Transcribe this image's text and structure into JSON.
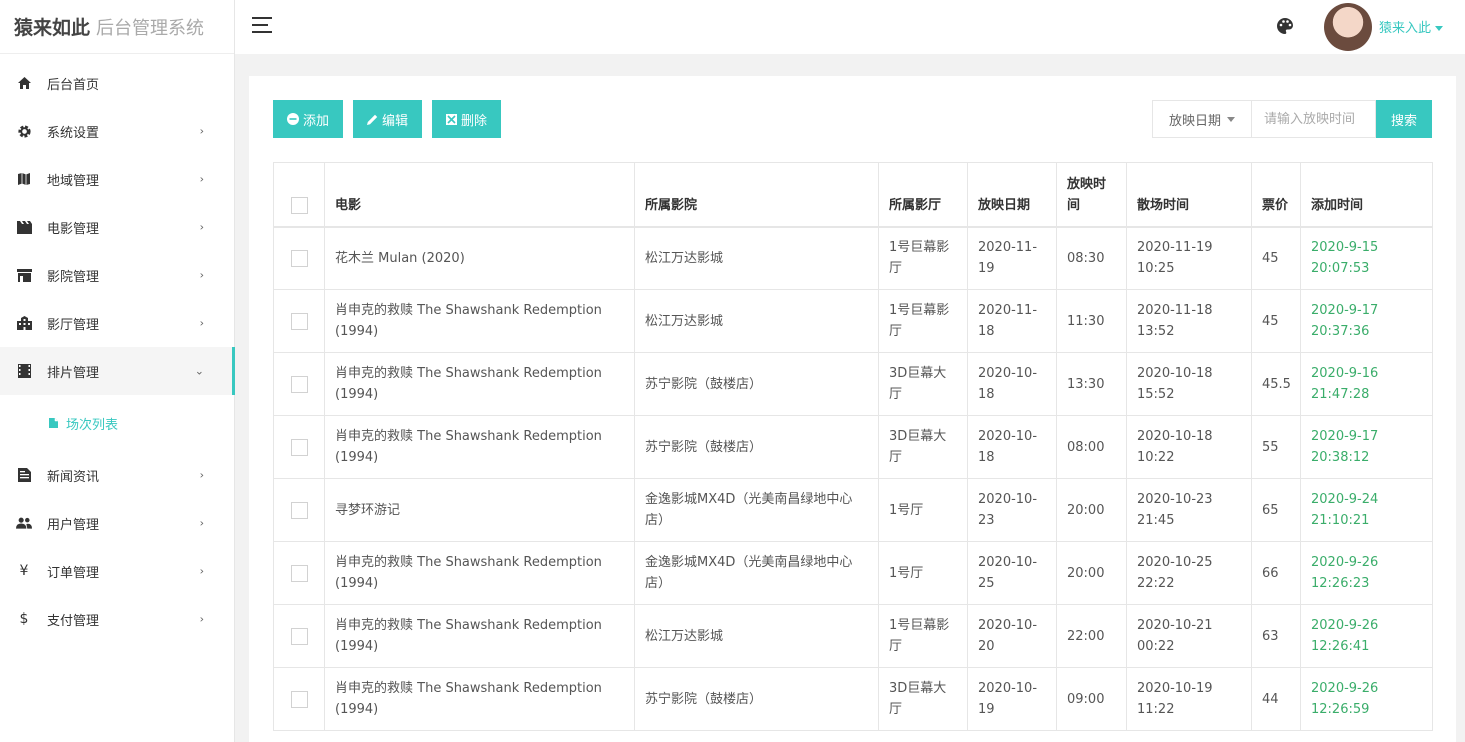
{
  "app": {
    "brand": "猿来如此",
    "subtitle": "后台管理系统"
  },
  "header": {
    "username": "猿来入此"
  },
  "colors": {
    "accent": "#38c8c0",
    "time_green": "#3aad6a"
  },
  "sidebar": {
    "items": [
      {
        "label": "后台首页",
        "icon": "home-icon"
      },
      {
        "label": "系统设置",
        "icon": "gear-icon"
      },
      {
        "label": "地域管理",
        "icon": "map-icon"
      },
      {
        "label": "电影管理",
        "icon": "film-icon"
      },
      {
        "label": "影院管理",
        "icon": "cinema-icon"
      },
      {
        "label": "影厅管理",
        "icon": "building-icon"
      },
      {
        "label": "排片管理",
        "icon": "schedule-icon"
      },
      {
        "label": "新闻资讯",
        "icon": "news-icon"
      },
      {
        "label": "用户管理",
        "icon": "users-icon"
      },
      {
        "label": "订单管理",
        "icon": "yen-icon"
      },
      {
        "label": "支付管理",
        "icon": "dollar-icon"
      }
    ],
    "subitem": {
      "label": "场次列表",
      "icon": "folder-icon"
    }
  },
  "toolbar": {
    "add_label": "添加",
    "edit_label": "编辑",
    "delete_label": "删除"
  },
  "search": {
    "field_label": "放映日期",
    "placeholder": "请输入放映时间",
    "button_label": "搜索"
  },
  "table": {
    "headers": [
      "电影",
      "所属影院",
      "所属影厅",
      "放映日期",
      "放映时间",
      "散场时间",
      "票价",
      "添加时间"
    ],
    "rows": [
      [
        "花木兰 Mulan (2020)",
        "松江万达影城",
        "1号巨幕影厅",
        "2020-11-19",
        "08:30",
        "2020-11-19 10:25",
        "45",
        "2020-9-15 20:07:53"
      ],
      [
        "肖申克的救赎 The Shawshank Redemption (1994)",
        "松江万达影城",
        "1号巨幕影厅",
        "2020-11-18",
        "11:30",
        "2020-11-18 13:52",
        "45",
        "2020-9-17 20:37:36"
      ],
      [
        "肖申克的救赎 The Shawshank Redemption (1994)",
        "苏宁影院（鼓楼店）",
        "3D巨幕大厅",
        "2020-10-18",
        "13:30",
        "2020-10-18 15:52",
        "45.5",
        "2020-9-16 21:47:28"
      ],
      [
        "肖申克的救赎 The Shawshank Redemption (1994)",
        "苏宁影院（鼓楼店）",
        "3D巨幕大厅",
        "2020-10-18",
        "08:00",
        "2020-10-18 10:22",
        "55",
        "2020-9-17 20:38:12"
      ],
      [
        "寻梦环游记",
        "金逸影城MX4D（光美南昌绿地中心店）",
        "1号厅",
        "2020-10-23",
        "20:00",
        "2020-10-23 21:45",
        "65",
        "2020-9-24 21:10:21"
      ],
      [
        "肖申克的救赎 The Shawshank Redemption (1994)",
        "金逸影城MX4D（光美南昌绿地中心店）",
        "1号厅",
        "2020-10-25",
        "20:00",
        "2020-10-25 22:22",
        "66",
        "2020-9-26 12:26:23"
      ],
      [
        "肖申克的救赎 The Shawshank Redemption (1994)",
        "松江万达影城",
        "1号巨幕影厅",
        "2020-10-20",
        "22:00",
        "2020-10-21 00:22",
        "63",
        "2020-9-26 12:26:41"
      ],
      [
        "肖申克的救赎 The Shawshank Redemption (1994)",
        "苏宁影院（鼓楼店）",
        "3D巨幕大厅",
        "2020-10-19",
        "09:00",
        "2020-10-19 11:22",
        "44",
        "2020-9-26 12:26:59"
      ]
    ]
  }
}
